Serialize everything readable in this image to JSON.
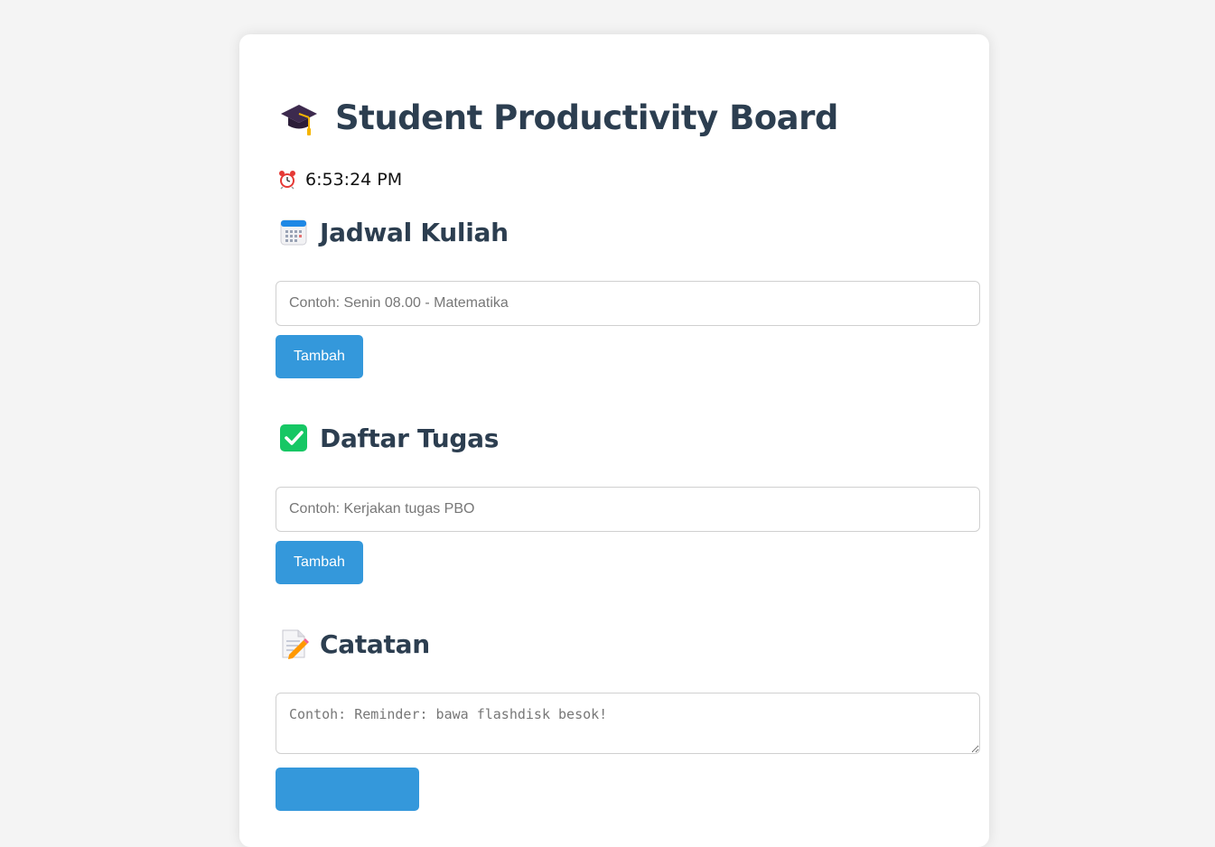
{
  "header": {
    "title": "Student Productivity Board",
    "title_icon": "graduation-cap-icon"
  },
  "clock": {
    "icon": "alarm-clock-icon",
    "time": "6:53:24 PM"
  },
  "sections": {
    "schedule": {
      "icon": "calendar-icon",
      "title": "Jadwal Kuliah",
      "placeholder": "Contoh: Senin 08.00 - Matematika",
      "button_label": "Tambah"
    },
    "tasks": {
      "icon": "check-box-icon",
      "title": "Daftar Tugas",
      "placeholder": "Contoh: Kerjakan tugas PBO",
      "button_label": "Tambah"
    },
    "notes": {
      "icon": "memo-icon",
      "title": "Catatan",
      "placeholder": "Contoh: Reminder: bawa flashdisk besok!"
    }
  },
  "colors": {
    "accent": "#3498db",
    "heading": "#2c3e50",
    "background": "#f4f4f4",
    "card": "#ffffff"
  }
}
